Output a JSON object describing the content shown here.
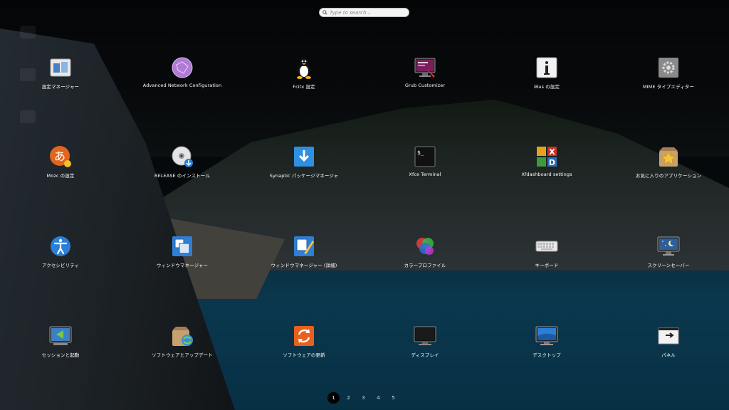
{
  "search": {
    "placeholder": "Type to search..."
  },
  "apps": [
    {
      "label": "設定マネージャー",
      "icon": "settings-manager-icon"
    },
    {
      "label": "Advanced Network Configuration",
      "icon": "network-config-icon"
    },
    {
      "label": "Fcitx 設定",
      "icon": "fcitx-penguin-icon"
    },
    {
      "label": "Grub Customizer",
      "icon": "grub-customizer-icon"
    },
    {
      "label": "iBus の設定",
      "icon": "ibus-info-icon"
    },
    {
      "label": "MIME タイプエディター",
      "icon": "mime-gear-icon"
    },
    {
      "label": "Mozc の設定",
      "icon": "mozc-icon"
    },
    {
      "label": "RELEASE のインストール",
      "icon": "installer-disc-icon"
    },
    {
      "label": "Synaptic パッケージマネージャ",
      "icon": "synaptic-download-icon"
    },
    {
      "label": "Xfce Terminal",
      "icon": "terminal-icon"
    },
    {
      "label": "Xfdashboard settings",
      "icon": "xfdashboard-icon"
    },
    {
      "label": "お気に入りのアプリケーション",
      "icon": "favorites-star-icon"
    },
    {
      "label": "アクセシビリティ",
      "icon": "accessibility-icon"
    },
    {
      "label": "ウィンドウマネージャー",
      "icon": "window-manager-icon"
    },
    {
      "label": "ウィンドウマネージャー (詳細)",
      "icon": "window-manager-tweaks-icon"
    },
    {
      "label": "カラープロファイル",
      "icon": "color-profile-icon"
    },
    {
      "label": "キーボード",
      "icon": "keyboard-icon"
    },
    {
      "label": "スクリーンセーバー",
      "icon": "screensaver-icon"
    },
    {
      "label": "セッションと起動",
      "icon": "session-startup-icon"
    },
    {
      "label": "ソフトウェアとアップデート",
      "icon": "software-updates-icon"
    },
    {
      "label": "ソフトウェアの更新",
      "icon": "software-updater-icon"
    },
    {
      "label": "ディスプレイ",
      "icon": "display-icon"
    },
    {
      "label": "デスクトップ",
      "icon": "desktop-icon"
    },
    {
      "label": "パネル",
      "icon": "panel-icon"
    }
  ],
  "pager": {
    "pages": [
      "1",
      "2",
      "3",
      "4",
      "5"
    ],
    "active": "1"
  }
}
